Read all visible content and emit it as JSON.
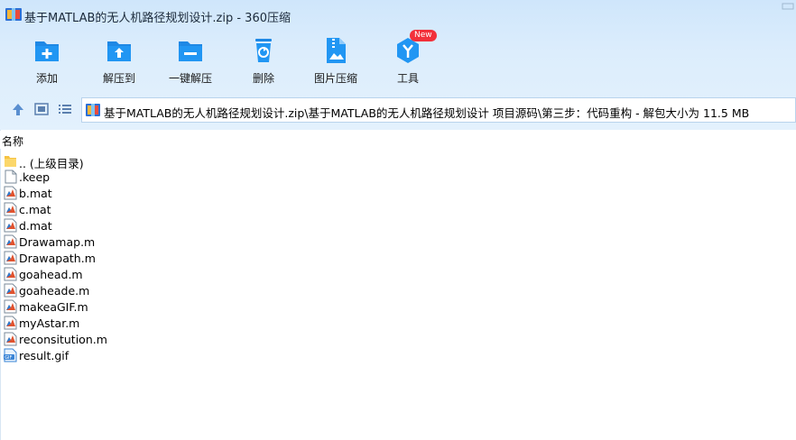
{
  "window": {
    "title": "基于MATLAB的无人机路径规划设计.zip - 360压缩",
    "app_icon": "archive-app-icon"
  },
  "toolbar": {
    "buttons": [
      {
        "label": "添加",
        "icon": "add-icon"
      },
      {
        "label": "解压到",
        "icon": "extract-to-icon"
      },
      {
        "label": "一键解压",
        "icon": "one-click-extract-icon"
      },
      {
        "label": "删除",
        "icon": "delete-icon"
      },
      {
        "label": "图片压缩",
        "icon": "image-compress-icon"
      },
      {
        "label": "工具",
        "icon": "tools-icon",
        "badge": "New"
      }
    ]
  },
  "nav": {
    "address": "基于MATLAB的无人机路径规划设计.zip\\基于MATLAB的无人机路径规划设计 项目源码\\第三步：代码重构 - 解包大小为 11.5 MB"
  },
  "columns": {
    "name": "名称"
  },
  "files": [
    {
      "name": ".. (上级目录)",
      "type": "folder"
    },
    {
      "name": ".keep",
      "type": "blank"
    },
    {
      "name": "b.mat",
      "type": "matlab"
    },
    {
      "name": "c.mat",
      "type": "matlab"
    },
    {
      "name": "d.mat",
      "type": "matlab"
    },
    {
      "name": "Drawamap.m",
      "type": "matlab"
    },
    {
      "name": "Drawapath.m",
      "type": "matlab"
    },
    {
      "name": "goahead.m",
      "type": "matlab"
    },
    {
      "name": "goaheade.m",
      "type": "matlab"
    },
    {
      "name": "makeaGIF.m",
      "type": "matlab"
    },
    {
      "name": "myAstar.m",
      "type": "matlab"
    },
    {
      "name": "reconsitution.m",
      "type": "matlab"
    },
    {
      "name": "result.gif",
      "type": "gif"
    }
  ],
  "colors": {
    "toolbar_icon": "#1e88e5",
    "badge": "#f2303a",
    "header_bg": "#dcedfc"
  }
}
